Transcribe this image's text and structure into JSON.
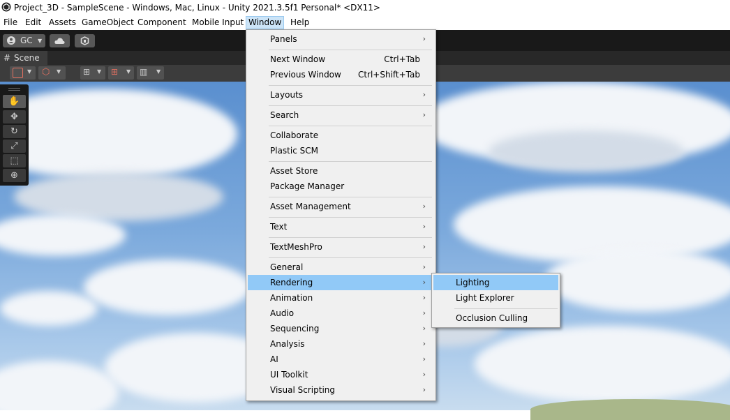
{
  "window": {
    "title": "Project_3D - SampleScene - Windows, Mac, Linux - Unity 2021.3.5f1 Personal* <DX11>"
  },
  "menubar": {
    "items": [
      "File",
      "Edit",
      "Assets",
      "GameObject",
      "Component",
      "Mobile Input",
      "Window",
      "Help"
    ]
  },
  "toolbar": {
    "account_label": "GC"
  },
  "scene": {
    "tab_label": "Scene"
  },
  "window_menu": {
    "panels": "Panels",
    "next_window": "Next Window",
    "next_window_sc": "Ctrl+Tab",
    "previous_window": "Previous Window",
    "previous_window_sc": "Ctrl+Shift+Tab",
    "layouts": "Layouts",
    "search": "Search",
    "collaborate": "Collaborate",
    "plastic_scm": "Plastic SCM",
    "asset_store": "Asset Store",
    "package_manager": "Package Manager",
    "asset_management": "Asset Management",
    "text": "Text",
    "textmeshpro": "TextMeshPro",
    "general": "General",
    "rendering": "Rendering",
    "animation": "Animation",
    "audio": "Audio",
    "sequencing": "Sequencing",
    "analysis": "Analysis",
    "ai": "AI",
    "ui_toolkit": "UI Toolkit",
    "visual_scripting": "Visual Scripting",
    "submenu_arrow": "›"
  },
  "rendering_submenu": {
    "lighting": "Lighting",
    "light_explorer": "Light Explorer",
    "occlusion_culling": "Occlusion Culling"
  },
  "colors": {
    "highlight": "#91c9f7",
    "active_menu": "#cce4f7",
    "toolbar_bg": "#191919"
  }
}
